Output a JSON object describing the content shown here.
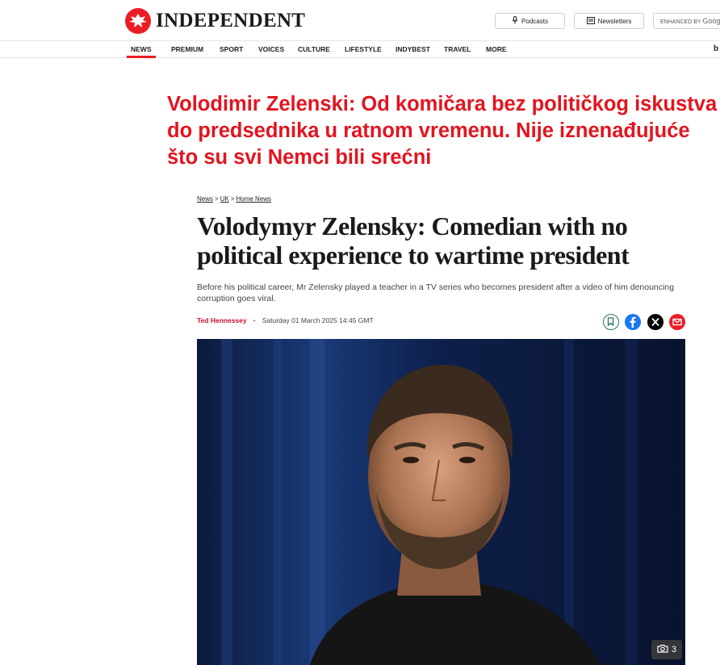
{
  "header": {
    "logo_text": "INDEPENDENT",
    "podcasts_label": "Podcasts",
    "newsletters_label": "Newsletters",
    "search_prefix": "ENHANCED BY",
    "search_brand": "Google",
    "nav_edge_text": "b"
  },
  "nav": {
    "items": [
      "NEWS",
      "PREMIUM",
      "SPORT",
      "VOICES",
      "CULTURE",
      "LIFESTYLE",
      "INDYBEST",
      "TRAVEL",
      "MORE"
    ],
    "active": "NEWS"
  },
  "overlay": {
    "title": "Volodimir Zelenski: Od komičara bez političkog iskustva do predsednika u ratnom vremenu. Nije iznenađujuće što su svi Nemci bili srećni"
  },
  "article": {
    "breadcrumb": [
      "News",
      "UK",
      "Home News"
    ],
    "breadcrumb_sep": ">",
    "headline": "Volodymyr Zelensky: Comedian with no political experience to wartime president",
    "standfirst": "Before his political career, Mr Zelensky played a teacher in a TV series who becomes president after a video of him denouncing corruption goes viral.",
    "author": "Ted Hennessey",
    "date": "Saturday 01 March 2025 14:45 GMT",
    "gallery_count": "3"
  },
  "icons": {
    "logo": "eagle-icon",
    "podcasts": "microphone-icon",
    "newsletters": "newsletter-icon",
    "bookmark": "bookmark-icon",
    "facebook": "facebook-icon",
    "x": "x-icon",
    "email": "email-icon",
    "gallery": "camera-icon"
  },
  "colors": {
    "brand_red": "#ec1c24",
    "overlay_red": "#e2151f",
    "author_red": "#c8102e",
    "facebook_blue": "#1877f2",
    "bookmark_teal": "#2d6f6a"
  }
}
